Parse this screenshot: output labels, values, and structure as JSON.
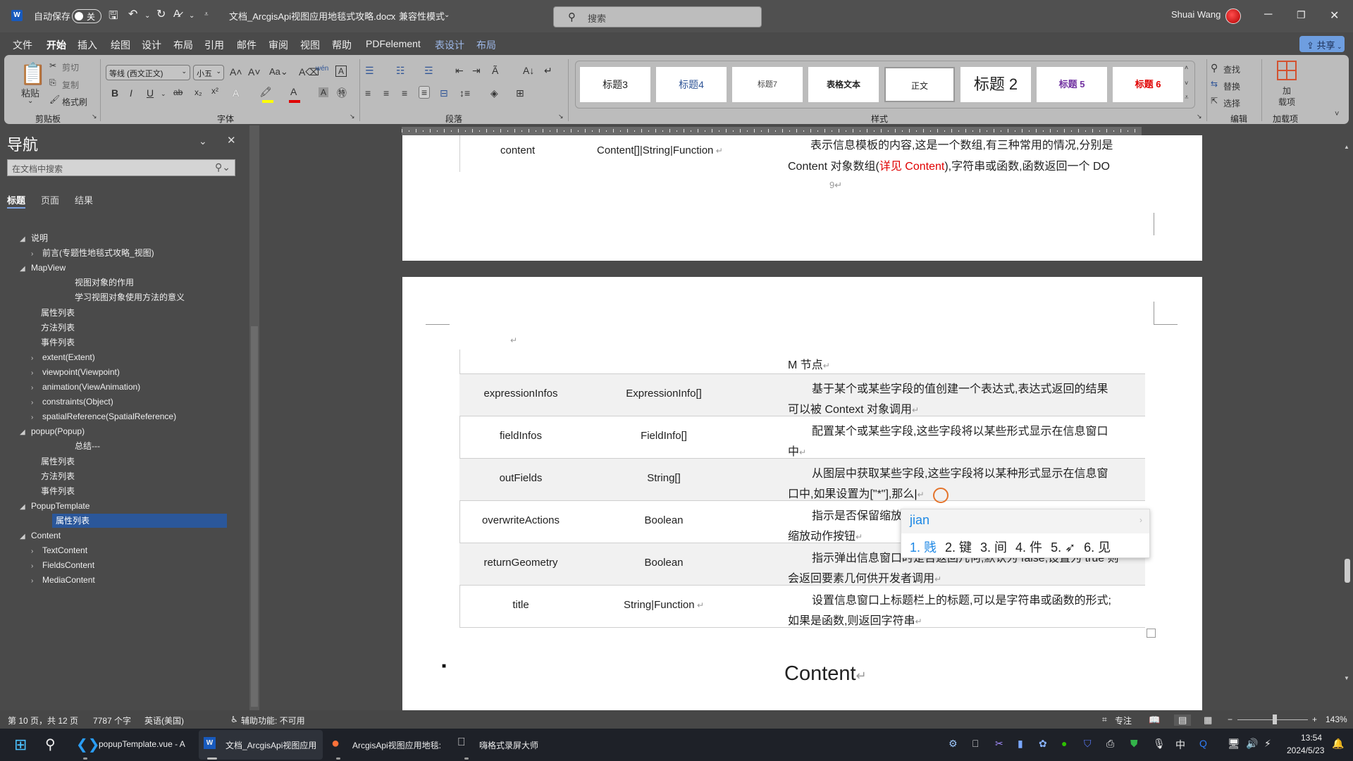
{
  "titlebar": {
    "autosave_label": "自动保存",
    "autosave_state": "关",
    "doc_title": "文档_ArcgisApi视图应用地毯式攻略.docx",
    "separator": "-",
    "mode": "兼容性模式",
    "search_placeholder": "搜索",
    "user_name": "Shuai Wang"
  },
  "tabs": [
    {
      "label": "文件"
    },
    {
      "label": "开始"
    },
    {
      "label": "插入"
    },
    {
      "label": "绘图"
    },
    {
      "label": "设计"
    },
    {
      "label": "布局"
    },
    {
      "label": "引用"
    },
    {
      "label": "邮件"
    },
    {
      "label": "审阅"
    },
    {
      "label": "视图"
    },
    {
      "label": "帮助"
    },
    {
      "label": "PDFelement"
    },
    {
      "label": "表设计"
    },
    {
      "label": "布局"
    }
  ],
  "share_label": "共享",
  "ribbon": {
    "clipboard": {
      "paste": "粘贴",
      "cut": "剪切",
      "copy": "复制",
      "format_painter": "格式刷",
      "group": "剪贴板"
    },
    "font": {
      "font_name": "等线 (西文正文)",
      "font_size": "小五",
      "group": "字体",
      "highlight_color": "#ffff00",
      "font_color": "#e00000"
    },
    "paragraph": {
      "group": "段落"
    },
    "styles": {
      "group": "样式",
      "tiles": [
        {
          "label": "标题3",
          "color": "#222222"
        },
        {
          "label": "标题4",
          "color": "#2f5597"
        },
        {
          "label": "标题7",
          "color": "#444444"
        },
        {
          "label": "表格文本",
          "color": "#111111"
        },
        {
          "label": "正文",
          "color": "#222222"
        },
        {
          "label": "标题 2",
          "color": "#222222"
        },
        {
          "label": "标题 5",
          "color": "#7030a0"
        },
        {
          "label": "标题 6",
          "color": "#e00000"
        }
      ]
    },
    "editing": {
      "find": "查找",
      "replace": "替换",
      "select": "选择",
      "group": "编辑"
    },
    "addins": {
      "label": "加载项",
      "btn_line1": "加",
      "btn_line2": "载项"
    }
  },
  "nav": {
    "title": "导航",
    "search_placeholder": "在文档中搜索",
    "tabs": [
      "标题",
      "页面",
      "结果"
    ],
    "items": [
      {
        "label": "说明",
        "marker": "◢"
      },
      {
        "label": "前言(专题性地毯式攻略_视图)",
        "marker": "›"
      },
      {
        "label": "MapView",
        "marker": "◢"
      },
      {
        "label": "视图对象的作用",
        "marker": ""
      },
      {
        "label": "学习视图对象使用方法的意义",
        "marker": ""
      },
      {
        "label": "属性列表",
        "marker": ""
      },
      {
        "label": "方法列表",
        "marker": ""
      },
      {
        "label": "事件列表",
        "marker": ""
      },
      {
        "label": "extent(Extent)",
        "marker": "›"
      },
      {
        "label": "viewpoint(Viewpoint)",
        "marker": "›"
      },
      {
        "label": "animation(ViewAnimation)",
        "marker": "›"
      },
      {
        "label": "constraints(Object)",
        "marker": "›"
      },
      {
        "label": "spatialReference(SpatialReference)",
        "marker": "›"
      },
      {
        "label": "popup(Popup)",
        "marker": "◢"
      },
      {
        "label": "总结---",
        "marker": ""
      },
      {
        "label": "属性列表",
        "marker": ""
      },
      {
        "label": "方法列表",
        "marker": ""
      },
      {
        "label": "事件列表",
        "marker": ""
      },
      {
        "label": "PopupTemplate",
        "marker": "◢"
      },
      {
        "label": "属性列表",
        "marker": "",
        "selected": true
      },
      {
        "label": "Content",
        "marker": "◢"
      },
      {
        "label": "TextContent",
        "marker": "›"
      },
      {
        "label": "FieldsContent",
        "marker": "›"
      },
      {
        "label": "MediaContent",
        "marker": "›"
      }
    ]
  },
  "document": {
    "page1_row": {
      "name": "content",
      "type": "Content[]|String|Function",
      "desc_line1": "表示信息模板的内容,这是一个数组,有三种常用的情况,分别是",
      "desc_line2_a": "Content 对象数组(",
      "desc_line2_link": "详见 Content",
      "desc_line2_b": "),字符串或函数,函数返回一个 DO",
      "page_num": "9"
    },
    "cont_line": "M 节点",
    "rows": [
      {
        "name": "expressionInfos",
        "type": "ExpressionInfo[]",
        "line1": "基于某个或某些字段的值创建一个表达式,表达式返回的结果",
        "line2": "可以被 Context 对象调用"
      },
      {
        "name": "fieldInfos",
        "type": "FieldInfo[]",
        "line1": "配置某个或某些字段,这些字段将以某些形式显示在信息窗口",
        "line2": "中"
      },
      {
        "name": "outFields",
        "type": "String[]",
        "line1": "从图层中获取某些字段,这些字段将以某种形式显示在信息窗",
        "line2": "口中,如果设置为[\"*\"],那么"
      },
      {
        "name": "overwriteActions",
        "type": "Boolean",
        "line1": "指示是否保留缩放动作按钮,默认为 false,设置为 true 时不保留",
        "line2": "缩放动作按钮"
      },
      {
        "name": "returnGeometry",
        "type": "Boolean",
        "line1": "指示弹出信息窗口时是否返回几何,默认为 false,设置为 true 则",
        "line2": "会返回要素几何供开发者调用"
      },
      {
        "name": "title",
        "type": "String|Function",
        "line1": "设置信息窗口上标题栏上的标题,可以是字符串或函数的形式;",
        "line2": "如果是函数,则返回字符串"
      }
    ],
    "heading": "Content"
  },
  "ime": {
    "composition": "jian",
    "candidates": [
      "1. 贱",
      "2. 键",
      "3. 间",
      "4. 件",
      "5. ➶",
      "6. 见"
    ]
  },
  "statusbar": {
    "page": "第 10 页，共 12 页",
    "words": "7787 个字",
    "language": "英语(美国)",
    "accessibility": "辅助功能: 不可用",
    "focus": "专注",
    "zoom_percent": "143%",
    "zoom_level": 143
  },
  "taskbar": {
    "apps": [
      {
        "label": "popupTemplate.vue - A"
      },
      {
        "label": "文档_ArcgisApi视图应用"
      },
      {
        "label": "ArcgisApi视图应用地毯:"
      },
      {
        "label": "嗨格式录屏大师"
      }
    ],
    "ime_indicator": "中",
    "time": "13:54",
    "date": "2024/5/23"
  }
}
